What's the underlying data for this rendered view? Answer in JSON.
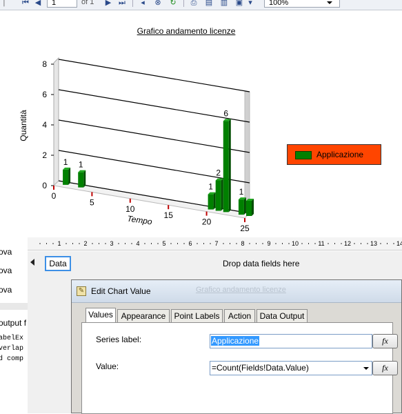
{
  "toolbar": {
    "page_value": "1",
    "page_of": "of 1",
    "zoom": "100%"
  },
  "chart": {
    "title": "Grafico andamento licenze",
    "ylabel": "Quantità",
    "xlabel": "Tempo",
    "legend_label": "Applicazione"
  },
  "chart_data": {
    "type": "bar",
    "title": "Grafico andamento licenze",
    "xlabel": "Tempo",
    "ylabel": "Quantità",
    "xlim": [
      0,
      25
    ],
    "ylim": [
      0,
      8
    ],
    "x_ticks": [
      "0",
      "5",
      "10",
      "15",
      "20",
      "25"
    ],
    "y_ticks": [
      "0",
      "2",
      "4",
      "6",
      "8"
    ],
    "legend": "right",
    "three_d": true,
    "colors": {
      "bars": "#008000",
      "legend_background": "#ff4500"
    },
    "series": [
      {
        "name": "Applicazione",
        "x": [
          1,
          3,
          20,
          21,
          22,
          24,
          25
        ],
        "values": [
          1,
          1,
          1,
          2,
          6,
          1,
          1
        ],
        "point_labels": [
          "1",
          "1",
          "1",
          "2",
          "6",
          "1",
          ""
        ]
      }
    ]
  },
  "designer": {
    "left_items": [
      "ova",
      "ova",
      "ova",
      "output f",
      "abelEx",
      "verlap",
      "d comp"
    ],
    "ruler_numbers": [
      "1",
      "2",
      "3",
      "4",
      "5",
      "6",
      "7",
      "8",
      "9",
      "10",
      "11",
      "12",
      "13",
      "14"
    ],
    "data_label": "Data",
    "drop_text": "Drop data fields here"
  },
  "dialog": {
    "title": "Edit Chart Value",
    "background_title": "Grafico andamento licenze",
    "tabs": [
      "Values",
      "Appearance",
      "Point Labels",
      "Action",
      "Data Output"
    ],
    "active_tab": "Values",
    "series_label_caption": "Series label:",
    "series_label_value": "Applicazione",
    "value_caption": "Value:",
    "value_expression": "=Count(Fields!Data.Value)",
    "fx_label": "fx"
  }
}
